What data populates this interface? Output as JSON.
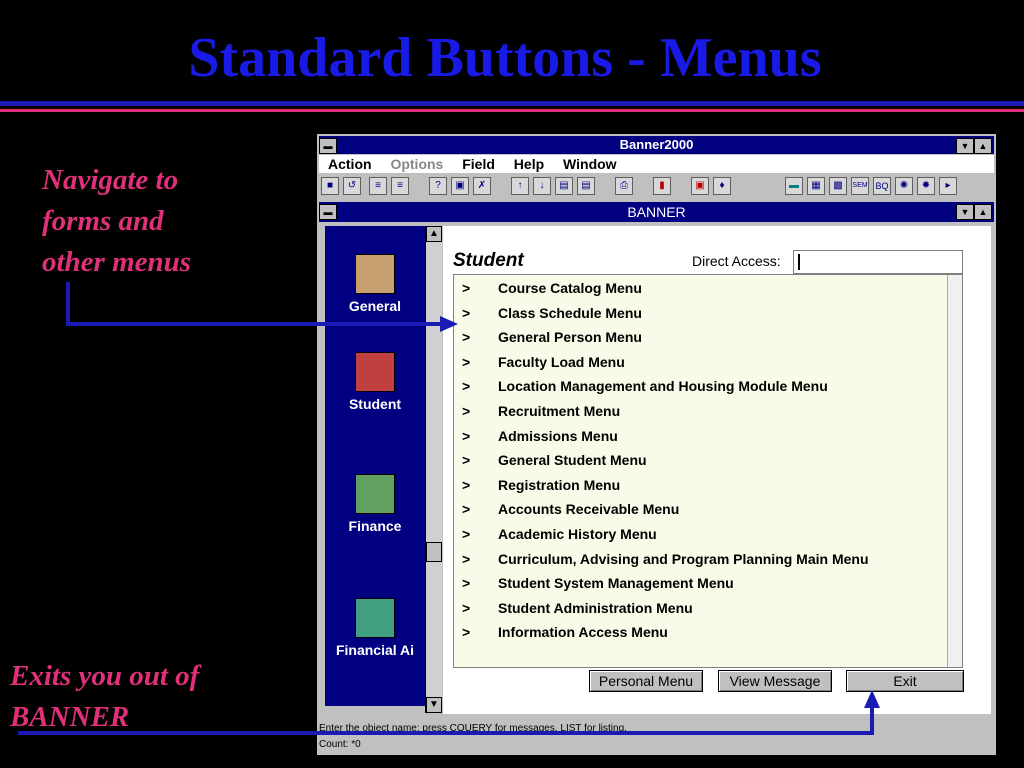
{
  "slide": {
    "title": "Standard Buttons - Menus",
    "callout_nav": "Navigate to\nforms and\nother menus",
    "callout_exit": "Exits you out of\nBANNER"
  },
  "window": {
    "title": "Banner2000",
    "menu": [
      "Action",
      "Options",
      "Field",
      "Help",
      "Window"
    ],
    "inner_title": "BANNER"
  },
  "nav": {
    "items": [
      {
        "label": "General",
        "icon": "general-icon"
      },
      {
        "label": "Student",
        "icon": "student-icon"
      },
      {
        "label": "Finance",
        "icon": "finance-icon"
      },
      {
        "label": "Financial Ai",
        "icon": "financial-aid-icon"
      }
    ]
  },
  "form": {
    "heading": "Student",
    "direct_access_label": "Direct Access:",
    "direct_access_value": "",
    "menu_items": [
      "Course Catalog Menu",
      "Class Schedule Menu",
      "General Person Menu",
      "Faculty Load Menu",
      "Location Management and Housing Module Menu",
      "Recruitment Menu",
      "Admissions Menu",
      "General Student Menu",
      "Registration Menu",
      "Accounts Receivable Menu",
      "Academic History Menu",
      "Curriculum, Advising and Program Planning Main Menu",
      "Student System Management Menu",
      "Student Administration Menu",
      "Information Access Menu"
    ],
    "item_marker": ">",
    "buttons": {
      "personal": "Personal Menu",
      "view_message": "View Message",
      "exit": "Exit"
    }
  },
  "status": {
    "line1": "Enter the object name; press COUERY for messages, LIST for listing.",
    "line2": "Count: *0"
  },
  "colors": {
    "title": "#1a1ae6",
    "callout": "#e0307a",
    "arrow": "#1a1ab4"
  }
}
